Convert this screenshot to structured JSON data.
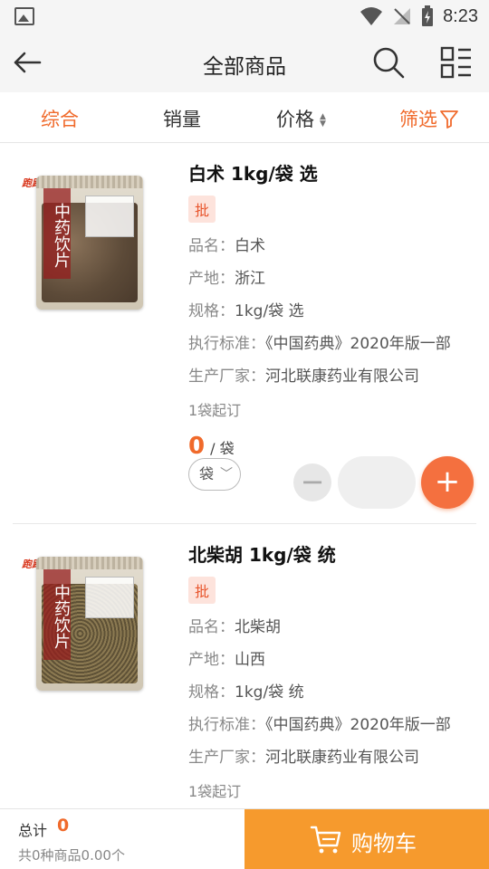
{
  "status_bar": {
    "time": "8:23"
  },
  "nav": {
    "title": "全部商品"
  },
  "sort_tabs": [
    {
      "label": "综合",
      "active": true
    },
    {
      "label": "销量",
      "active": false
    },
    {
      "label": "价格",
      "active": false
    },
    {
      "label": "筛选",
      "active": true
    }
  ],
  "products": [
    {
      "name": "白术 1kg/袋 选",
      "badge": "批",
      "brand": "跑跑药房",
      "bag_text": "中药饮片",
      "attrs": [
        {
          "key": "品名：",
          "value": "白术"
        },
        {
          "key": "产地：",
          "value": "浙江"
        },
        {
          "key": "规格：",
          "value": "1kg/袋 选"
        },
        {
          "key": "执行标准：",
          "value": "《中国药典》2020年版一部"
        },
        {
          "key": "生产厂家：",
          "value": "河北联康药业有限公司"
        }
      ],
      "min_order": "1袋起订",
      "price": "0",
      "price_unit": "/ 袋",
      "unit_select": "袋",
      "fill_color": "#6e5a45"
    },
    {
      "name": "北柴胡 1kg/袋 统",
      "badge": "批",
      "brand": "跑跑药房",
      "bag_text": "中药饮片",
      "attrs": [
        {
          "key": "品名：",
          "value": "北柴胡"
        },
        {
          "key": "产地：",
          "value": "山西"
        },
        {
          "key": "规格：",
          "value": "1kg/袋 统"
        },
        {
          "key": "执行标准：",
          "value": "《中国药典》2020年版一部"
        },
        {
          "key": "生产厂家：",
          "value": "河北联康药业有限公司"
        }
      ],
      "min_order": "1袋起订",
      "price": "0",
      "price_unit": "/ 袋",
      "unit_select": "袋",
      "fill_color": "#7a6a48"
    }
  ],
  "bottom": {
    "total_label": "总计",
    "total_value": "0",
    "summary": "共0种商品0.00个",
    "cart_label": "购物车"
  },
  "colors": {
    "accent": "#f06a2b",
    "cart": "#f69a2d"
  }
}
